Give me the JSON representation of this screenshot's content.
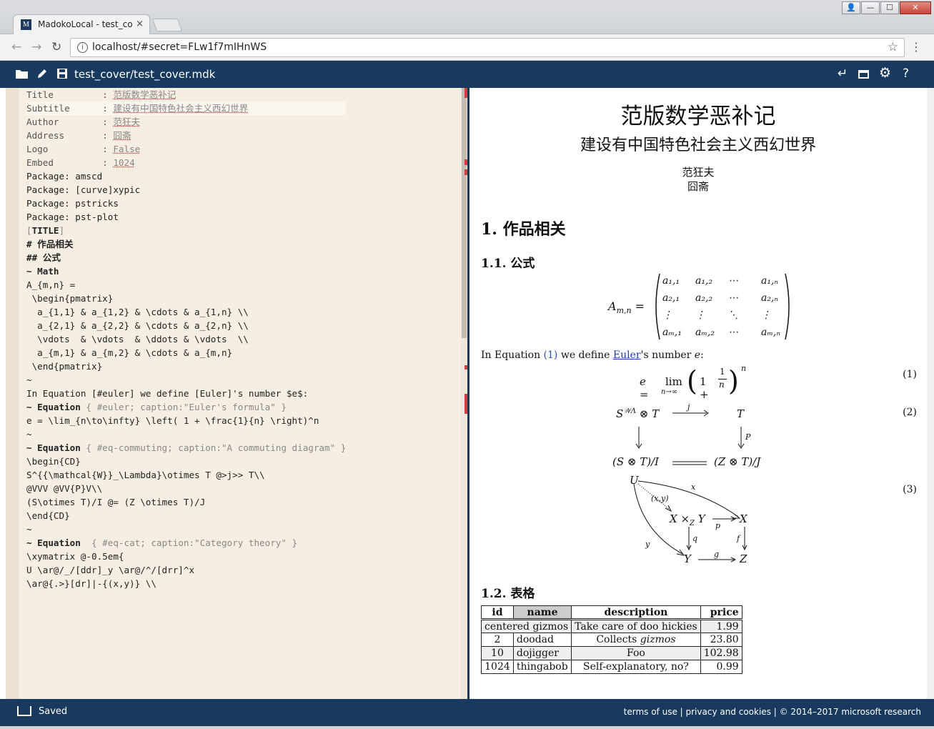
{
  "window": {
    "controls": {
      "min": "—",
      "max": "☐",
      "close": "✕",
      "user": "👤"
    }
  },
  "tab": {
    "favicon": "M",
    "title": "MadokoLocal - test_co",
    "close": "×"
  },
  "toolbar": {
    "url": "localhost/#secret=FLw1f7mIHnWS"
  },
  "appbar": {
    "filename": "test_cover/test_cover.mdk"
  },
  "editor": {
    "lines": [
      "Title         : 范版数学恶补记",
      "Subtitle      : 建设有中国特色社会主义西幻世界",
      "Author        : 范狂夫",
      "Address       : 囧斋",
      "Logo          : False",
      "Embed         : 1024",
      "Package: amscd",
      "Package: [curve]xypic",
      "Package: pstricks",
      "Package: pst-plot",
      "",
      "[TITLE]",
      "",
      "# 作品相关",
      "",
      "## 公式",
      "",
      "~ Math",
      "A_{m,n} =",
      " \\begin{pmatrix}",
      "  a_{1,1} & a_{1,2} & \\cdots & a_{1,n} \\\\",
      "  a_{2,1} & a_{2,2} & \\cdots & a_{2,n} \\\\",
      "  \\vdots  & \\vdots  & \\ddots & \\vdots  \\\\",
      "  a_{m,1} & a_{m,2} & \\cdots & a_{m,n}",
      " \\end{pmatrix}",
      "~",
      "",
      "In Equation [#euler] we define [Euler]'s number $e$:",
      "",
      "~ Equation { #euler; caption:\"Euler's formula\" }",
      "e = \\lim_{n\\to\\infty} \\left( 1 + \\frac{1}{n} \\right)^n",
      "~",
      "",
      "~ Equation { #eq-commuting; caption:\"A commuting diagram\" }",
      "\\begin{CD}",
      "S^{{\\mathcal{W}}_\\Lambda}\\otimes T @>j>> T\\\\",
      "@VVV @VV{P}V\\\\",
      "(S\\otimes T)/I @= (Z \\otimes T)/J",
      "\\end{CD}",
      "~",
      "",
      "~ Equation  { #eq-cat; caption:\"Category theory\" }",
      "\\xymatrix @-0.5em{",
      "U \\ar@/_/[ddr]_y \\ar@/^/[drr]^x",
      "\\ar@{.>}[dr]|-{(x,y)} \\\\"
    ]
  },
  "preview": {
    "title": "范版数学恶补记",
    "subtitle": "建设有中国特色社会主义西幻世界",
    "author": "范狂夫",
    "address": "囧斋",
    "h1": "1.  作品相关",
    "h2_formula": "1.1.  公式",
    "matrix_lhs": "A",
    "matrix_lhs_sub": "m,n",
    "matrix_rows": [
      [
        "a₁,₁",
        "a₁,₂",
        "⋯",
        "a₁,ₙ"
      ],
      [
        "a₂,₁",
        "a₂,₂",
        "⋯",
        "a₂,ₙ"
      ],
      [
        "⋮",
        "⋮",
        "⋱",
        "⋮"
      ],
      [
        "aₘ,₁",
        "aₘ,₂",
        "⋯",
        "aₘ,ₙ"
      ]
    ],
    "sentence_pre": "In Equation ",
    "sentence_ref": "(1)",
    "sentence_mid": " we define ",
    "sentence_link": "Euler",
    "sentence_post": "'s number ",
    "sentence_var": "e",
    "sentence_end": ":",
    "eq_numbers": [
      "(1)",
      "(2)",
      "(3)"
    ],
    "cd": {
      "tl": "S",
      "tl_sup": "𝒲Λ",
      "tl_rest": " ⊗ T",
      "arrow_label": "j",
      "tr": "T",
      "right_label": "P",
      "bl": "(S ⊗ T)/I",
      "br": "(Z ⊗ T)/J"
    },
    "xy": {
      "U": "U",
      "x": "x",
      "y": "y",
      "xy": "(x,y)",
      "pullback": "X ×",
      "pullback_sub": "Z",
      "pullback_rest": " Y",
      "X": "X",
      "Y": "Y",
      "Z": "Z",
      "p": "p",
      "q": "q",
      "f": "f",
      "g": "g"
    },
    "h2_table": "1.2.  表格",
    "table": {
      "headers": [
        "id",
        "name",
        "description",
        "price"
      ],
      "rows": [
        [
          "centered gizmos",
          "Take care of doo hickies",
          "1.99"
        ],
        [
          "2",
          "doodad",
          "Collects gizmos",
          "23.80"
        ],
        [
          "10",
          "dojigger",
          "Foo",
          "102.98"
        ],
        [
          "1024",
          "thingabob",
          "Self-explanatory, no?",
          "0.99"
        ]
      ]
    }
  },
  "status": {
    "saved": "Saved",
    "footer": "terms of use | privacy and cookies | © 2014–2017 microsoft research"
  }
}
